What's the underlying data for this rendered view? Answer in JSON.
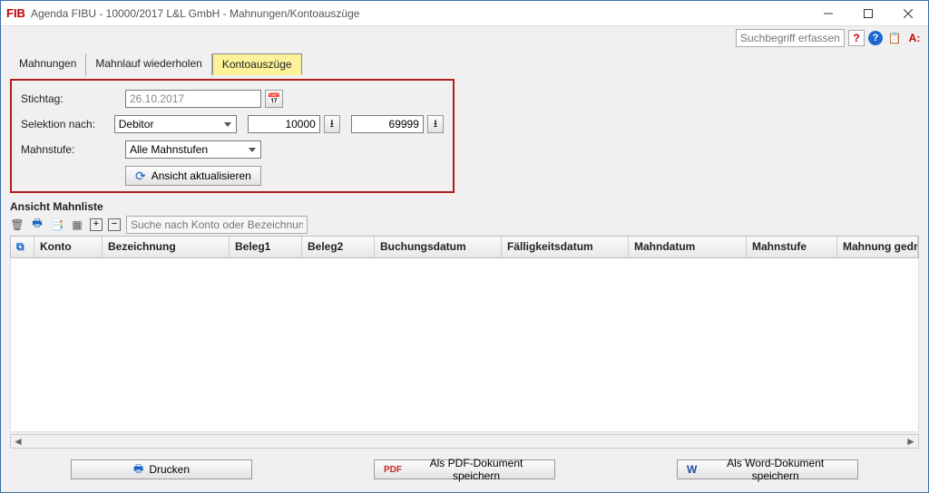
{
  "window": {
    "logo": "FIB",
    "title": "Agenda FIBU - 10000/2017 L&L GmbH - Mahnungen/Kontoauszüge"
  },
  "toolbar": {
    "search_placeholder": "Suchbegriff erfassen...",
    "A_glyph": "A:"
  },
  "tabs": {
    "t1": "Mahnungen",
    "t2": "Mahnlauf wiederholen",
    "t3": "Kontoauszüge"
  },
  "form": {
    "stichtag_label": "Stichtag:",
    "stichtag_value": "26.10.2017",
    "selektion_label": "Selektion nach:",
    "selektion_value": "Debitor",
    "range_from": "10000",
    "range_to": "69999",
    "mahnstufe_label": "Mahnstufe:",
    "mahnstufe_value": "Alle Mahnstufen",
    "refresh_label": "Ansicht aktualisieren"
  },
  "list": {
    "header": "Ansicht Mahnliste",
    "filter_placeholder": "Suche nach Konto oder Bezeichnung"
  },
  "columns": {
    "konto": "Konto",
    "bezeichnung": "Bezeichnung",
    "beleg1": "Beleg1",
    "beleg2": "Beleg2",
    "buchungsdatum": "Buchungsdatum",
    "faelligkeitsdatum": "Fälligkeitsdatum",
    "mahndatum": "Mahndatum",
    "mahnstufe": "Mahnstufe",
    "mahnung_gedruckt": "Mahnung gedruckt"
  },
  "footer": {
    "print": "Drucken",
    "pdf": "Als PDF-Dokument speichern",
    "word": "Als Word-Dokument speichern"
  }
}
